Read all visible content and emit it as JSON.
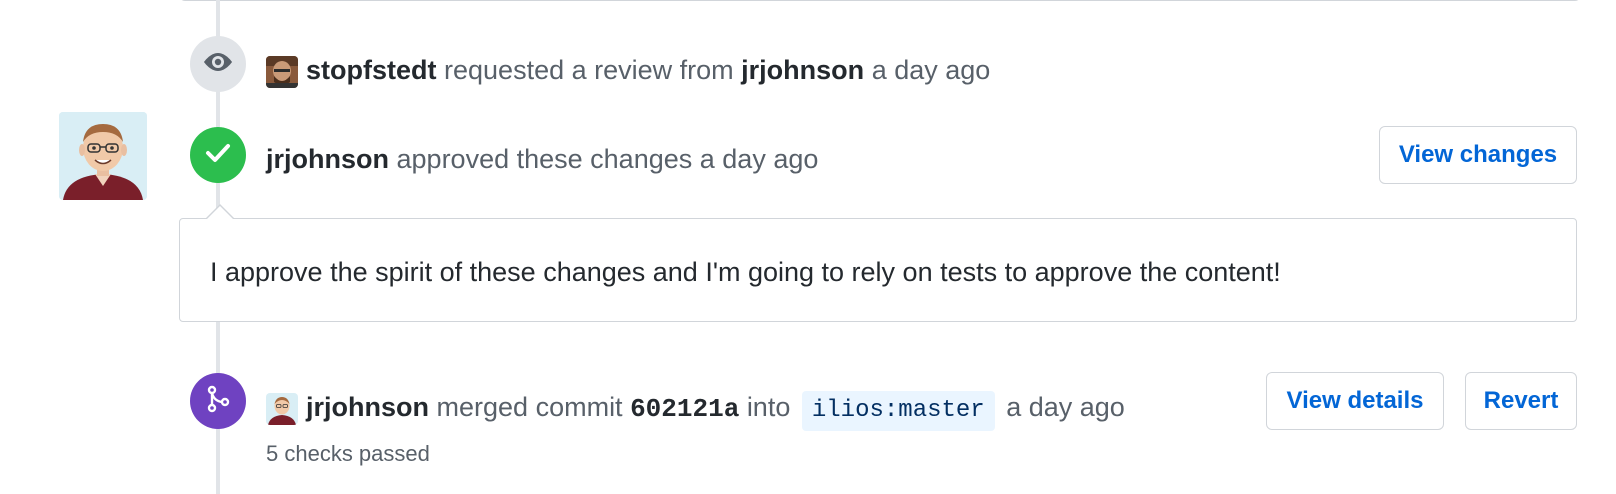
{
  "review_request": {
    "actor": "stopfstedt",
    "action": "requested a review from",
    "reviewer": "jrjohnson",
    "time": "a day ago",
    "icon": "eye-icon"
  },
  "approval": {
    "actor": "jrjohnson",
    "action": "approved these changes",
    "time": "a day ago",
    "icon": "check-icon",
    "view_changes_label": "View changes",
    "comment": "I approve the spirit of these changes and I'm going to rely on tests to approve the content!"
  },
  "merge": {
    "actor": "jrjohnson",
    "action": "merged commit",
    "commit": "602121a",
    "into": "into",
    "branch": "ilios:master",
    "time": "a day ago",
    "checks": "5 checks passed",
    "icon": "git-merge-icon",
    "view_details_label": "View details",
    "revert_label": "Revert"
  },
  "colors": {
    "approved_badge": "#2cbe4e",
    "merged_badge": "#6f42c1",
    "review_badge": "#e1e4e8",
    "link": "#0366d6"
  }
}
